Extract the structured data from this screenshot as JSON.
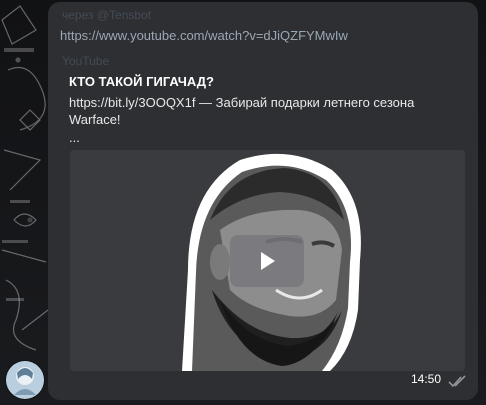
{
  "message": {
    "forwarded_from": "через @Tensbot",
    "url": "https://www.youtube.com/watch?v=dJiQZFYMwIw",
    "preview": {
      "site": "YouTube",
      "title": "КТО ТАКОЙ ГИГАЧАД?",
      "description": "https://bit.ly/3OOQX1f — Забирай подарки летнего сезона Warface!",
      "more": "...",
      "thumbnail_icon": "gigachad-thumbnail",
      "play_icon": "play-icon"
    },
    "time": "14:50",
    "status_icon": "double-check-icon"
  },
  "colors": {
    "bubble": "#2e2f33",
    "link": "#9aa7b4",
    "title": "#ffffff",
    "text": "#e8e8e8"
  }
}
